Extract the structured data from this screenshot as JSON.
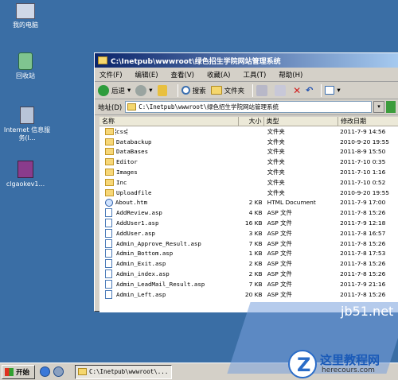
{
  "desktop": {
    "icons": [
      {
        "label": "我的电脑"
      },
      {
        "label": "回收站"
      },
      {
        "label": "Internet 信息服务(I..."
      },
      {
        "label": "clgaokev1..."
      }
    ]
  },
  "window": {
    "title": "C:\\Inetpub\\wwwroot\\绿色招生学院网站管理系统",
    "menu": [
      "文件(F)",
      "编辑(E)",
      "查看(V)",
      "收藏(A)",
      "工具(T)",
      "帮助(H)"
    ],
    "toolbar": {
      "back": "后退",
      "search": "搜索",
      "folders": "文件夹"
    },
    "address": {
      "label": "地址(D)",
      "value": "C:\\Inetpub\\wwwroot\\绿色招生学院网站管理系统"
    },
    "columns": {
      "name": "名称",
      "size": "大小",
      "type": "类型",
      "date": "修改日期"
    },
    "files": [
      {
        "name": "css",
        "size": "",
        "type": "文件夹",
        "date": "2011-7-9 14:56",
        "kind": "folder"
      },
      {
        "name": "Databackup",
        "size": "",
        "type": "文件夹",
        "date": "2010-9-20 19:55",
        "kind": "folder"
      },
      {
        "name": "DataBases",
        "size": "",
        "type": "文件夹",
        "date": "2011-8-9 15:50",
        "kind": "folder"
      },
      {
        "name": "Editor",
        "size": "",
        "type": "文件夹",
        "date": "2011-7-10 0:35",
        "kind": "folder"
      },
      {
        "name": "Images",
        "size": "",
        "type": "文件夹",
        "date": "2011-7-10 1:16",
        "kind": "folder"
      },
      {
        "name": "Inc",
        "size": "",
        "type": "文件夹",
        "date": "2011-7-10 0:52",
        "kind": "folder"
      },
      {
        "name": "Uploadfile",
        "size": "",
        "type": "文件夹",
        "date": "2010-9-20 19:55",
        "kind": "folder"
      },
      {
        "name": "About.htm",
        "size": "2 KB",
        "type": "HTML Document",
        "date": "2011-7-9 17:00",
        "kind": "html"
      },
      {
        "name": "AddReview.asp",
        "size": "4 KB",
        "type": "ASP 文件",
        "date": "2011-7-8 15:26",
        "kind": "file"
      },
      {
        "name": "AddUser1.asp",
        "size": "16 KB",
        "type": "ASP 文件",
        "date": "2011-7-9 12:18",
        "kind": "file"
      },
      {
        "name": "AddUser.asp",
        "size": "3 KB",
        "type": "ASP 文件",
        "date": "2011-7-8 16:57",
        "kind": "file"
      },
      {
        "name": "Admin_Approve_Result.asp",
        "size": "7 KB",
        "type": "ASP 文件",
        "date": "2011-7-8 15:26",
        "kind": "file"
      },
      {
        "name": "Admin_Bottom.asp",
        "size": "1 KB",
        "type": "ASP 文件",
        "date": "2011-7-8 17:53",
        "kind": "file"
      },
      {
        "name": "Admin_Exit.asp",
        "size": "2 KB",
        "type": "ASP 文件",
        "date": "2011-7-8 15:26",
        "kind": "file"
      },
      {
        "name": "Admin_index.asp",
        "size": "2 KB",
        "type": "ASP 文件",
        "date": "2011-7-8 15:26",
        "kind": "file"
      },
      {
        "name": "Admin_LeadMail_Result.asp",
        "size": "7 KB",
        "type": "ASP 文件",
        "date": "2011-7-9 21:16",
        "kind": "file"
      },
      {
        "name": "Admin_Left.asp",
        "size": "20 KB",
        "type": "ASP 文件",
        "date": "2011-7-8 15:26",
        "kind": "file"
      }
    ]
  },
  "taskbar": {
    "start": "开始",
    "task": "C:\\Inetpub\\wwwroot\\..."
  },
  "watermark": {
    "jb": "jb51.net",
    "site_name": "这里教程网",
    "site_url": "herecours.com"
  }
}
